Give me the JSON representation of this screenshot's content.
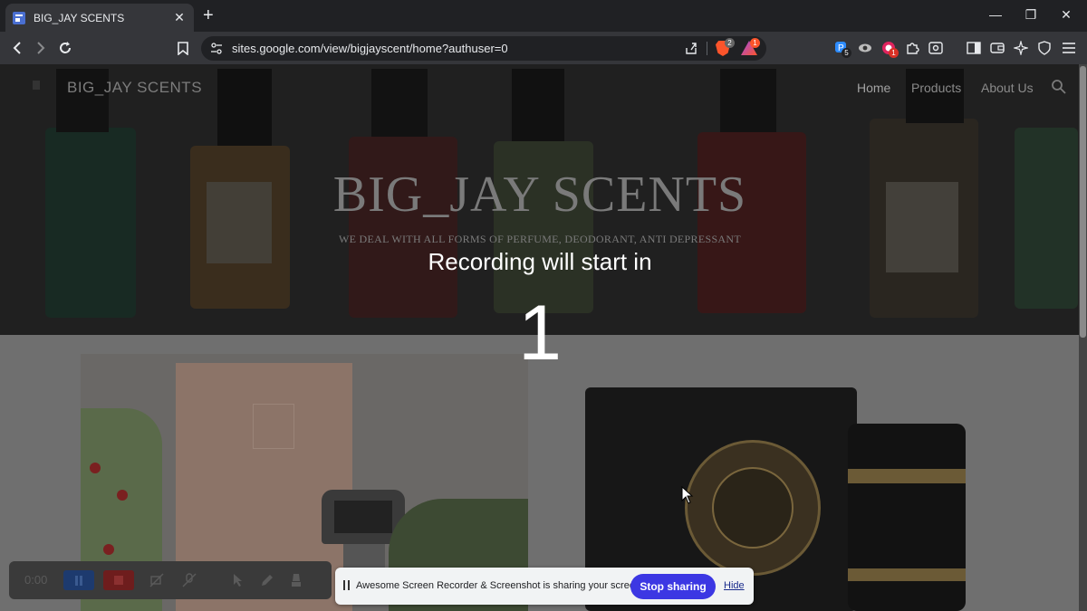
{
  "browser": {
    "tab_title": "BIG_JAY SCENTS",
    "tab_close": "✕",
    "new_tab": "+",
    "window_minimize": "—",
    "window_restore": "❐",
    "window_close": "✕",
    "url": "sites.google.com/view/bigjayscent/home?authuser=0",
    "brave_shields_count": "2",
    "rewards_count": "1",
    "extension_badge_p": "5",
    "extension_badge_c": "1"
  },
  "site": {
    "name": "BIG_JAY SCENTS",
    "nav": [
      "Home",
      "Products",
      "About Us"
    ],
    "hero_title": "BIG_JAY SCENTS",
    "hero_subtitle": "WE DEAL WITH ALL FORMS OF PERFUME, DEODORANT, ANTI DEPRESSANT"
  },
  "countdown": {
    "label": "Recording will start in",
    "number": "1"
  },
  "recorder": {
    "time": "0:00"
  },
  "sharing": {
    "message": "Awesome Screen Recorder & Screenshot is sharing your screen.",
    "stop_label": "Stop sharing",
    "hide_label": "Hide"
  },
  "colors": {
    "stop_button": "#3c37e3",
    "brave_orange": "#fb542b"
  }
}
